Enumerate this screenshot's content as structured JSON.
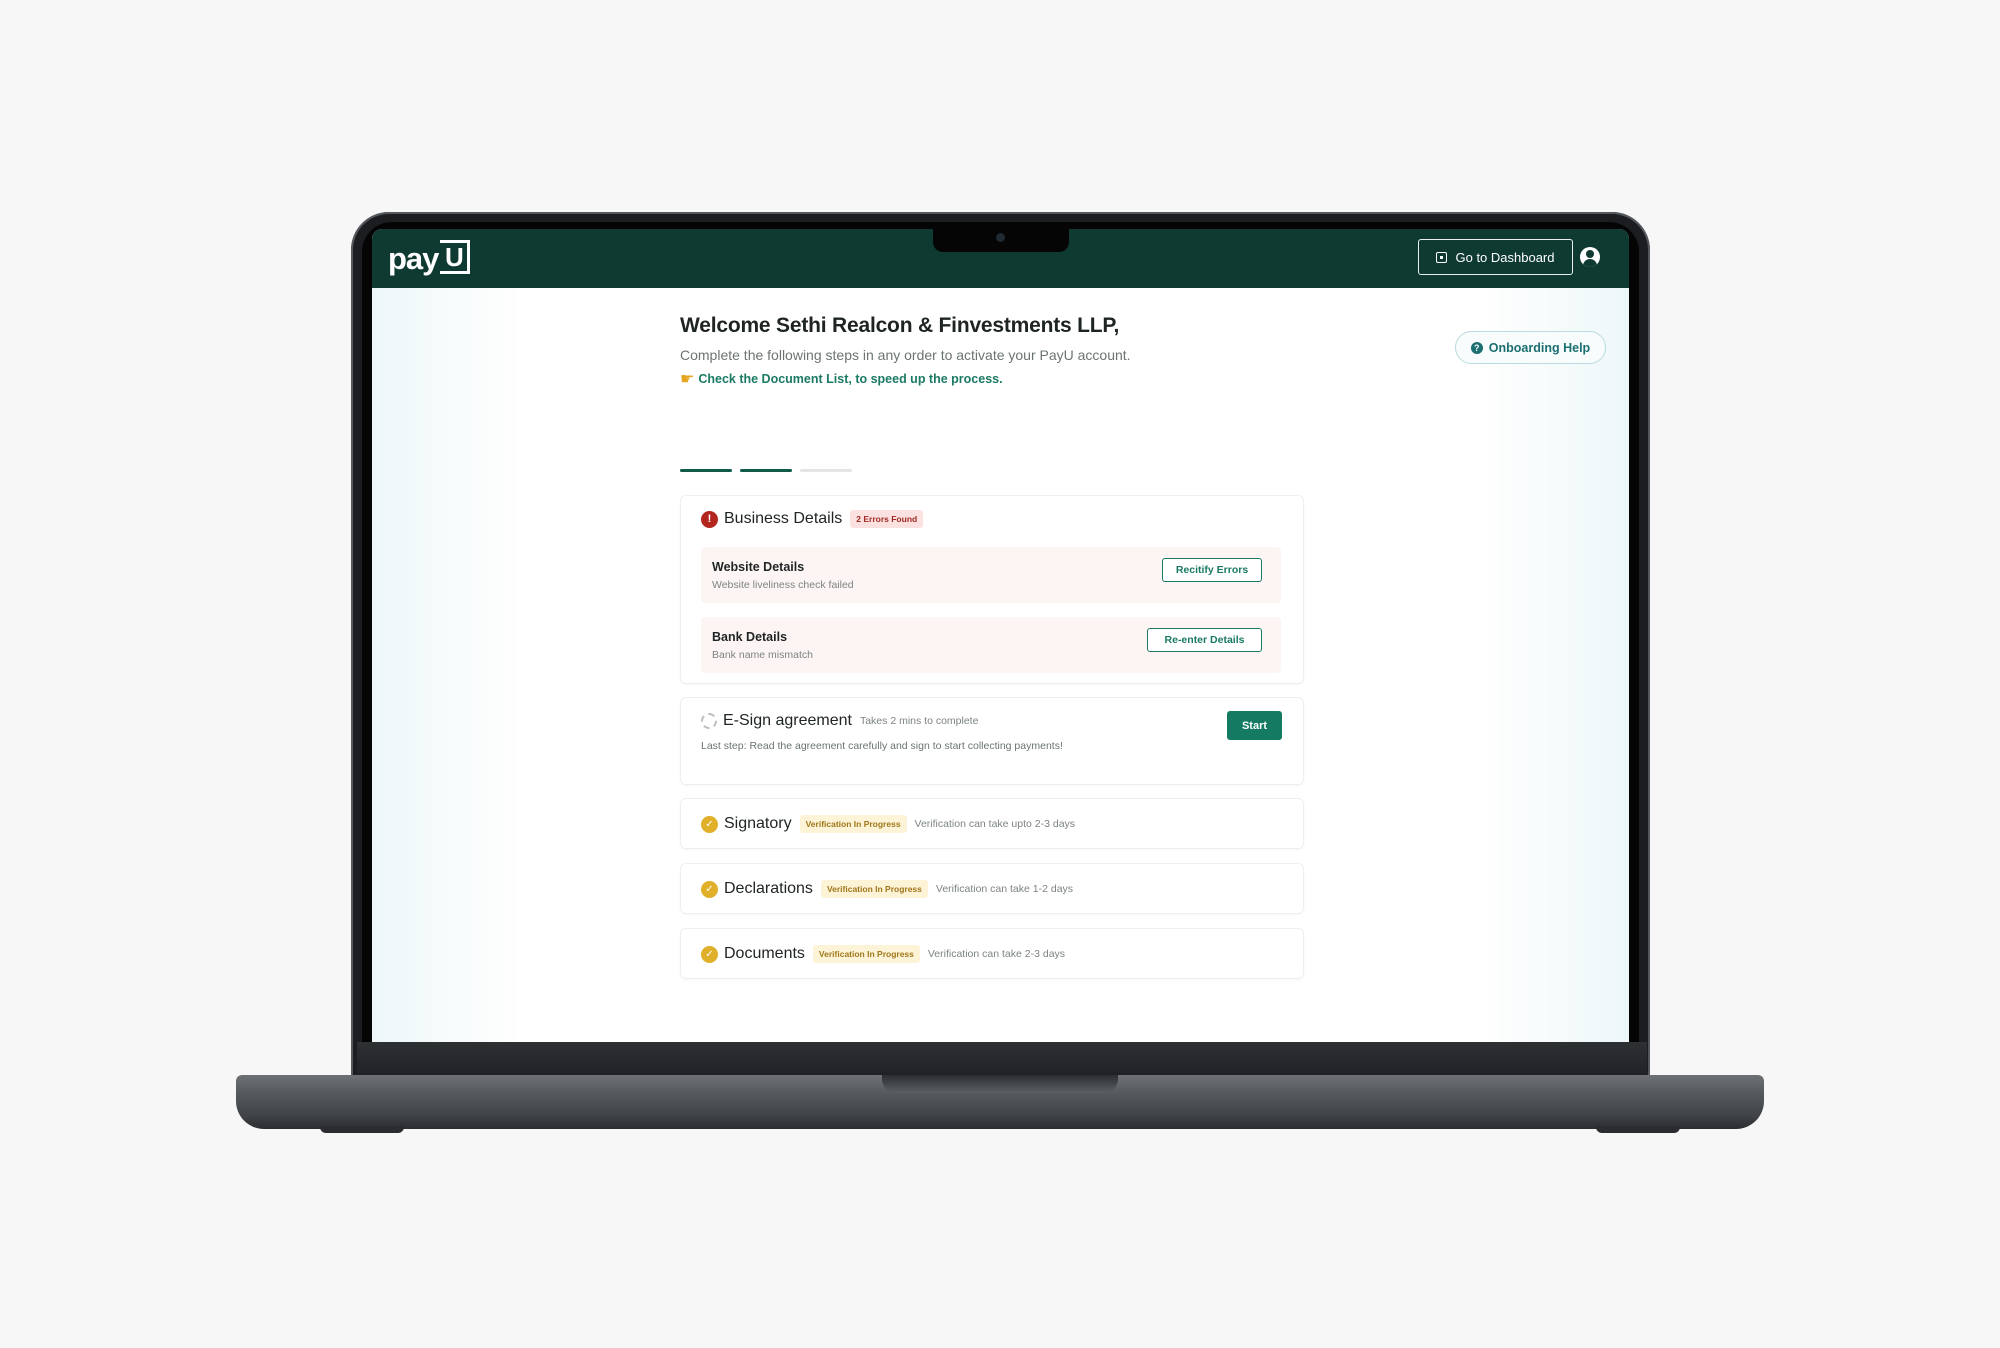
{
  "header": {
    "logo_text": "pay",
    "logo_box_text": "U",
    "dashboard_button": "Go to Dashboard"
  },
  "help_button": "Onboarding Help",
  "welcome": {
    "title": "Welcome Sethi Realcon & Finvestments LLP,",
    "subtitle": "Complete the following steps in any order to activate your PayU account.",
    "document_link": "Check the Document List, to speed up the process."
  },
  "progress": {
    "steps_total": 3,
    "steps_completed": 2
  },
  "business_details": {
    "title": "Business Details",
    "badge": "2 Errors Found",
    "rows": [
      {
        "title": "Website Details",
        "description": "Website liveliness check failed",
        "action": "Recitify Errors"
      },
      {
        "title": "Bank Details",
        "description": "Bank name mismatch",
        "action": "Re-enter Details"
      }
    ]
  },
  "esign": {
    "title": "E-Sign agreement",
    "meta": "Takes 2 mins to complete",
    "description": "Last step: Read the agreement carefully and sign to start collecting payments!",
    "action": "Start"
  },
  "signatory": {
    "title": "Signatory",
    "badge": "Verification In Progress",
    "meta": "Verification can take upto 2-3 days"
  },
  "declarations": {
    "title": "Declarations",
    "badge": "Verification In Progress",
    "meta": "Verification can take 1-2 days"
  },
  "documents": {
    "title": "Documents",
    "badge": "Verification In Progress",
    "meta": "Verification can take 2-3 days"
  },
  "colors": {
    "topbar": "#0f3a32",
    "accent": "#147a62",
    "error": "#b3261e",
    "in_progress": "#e0b02a"
  }
}
